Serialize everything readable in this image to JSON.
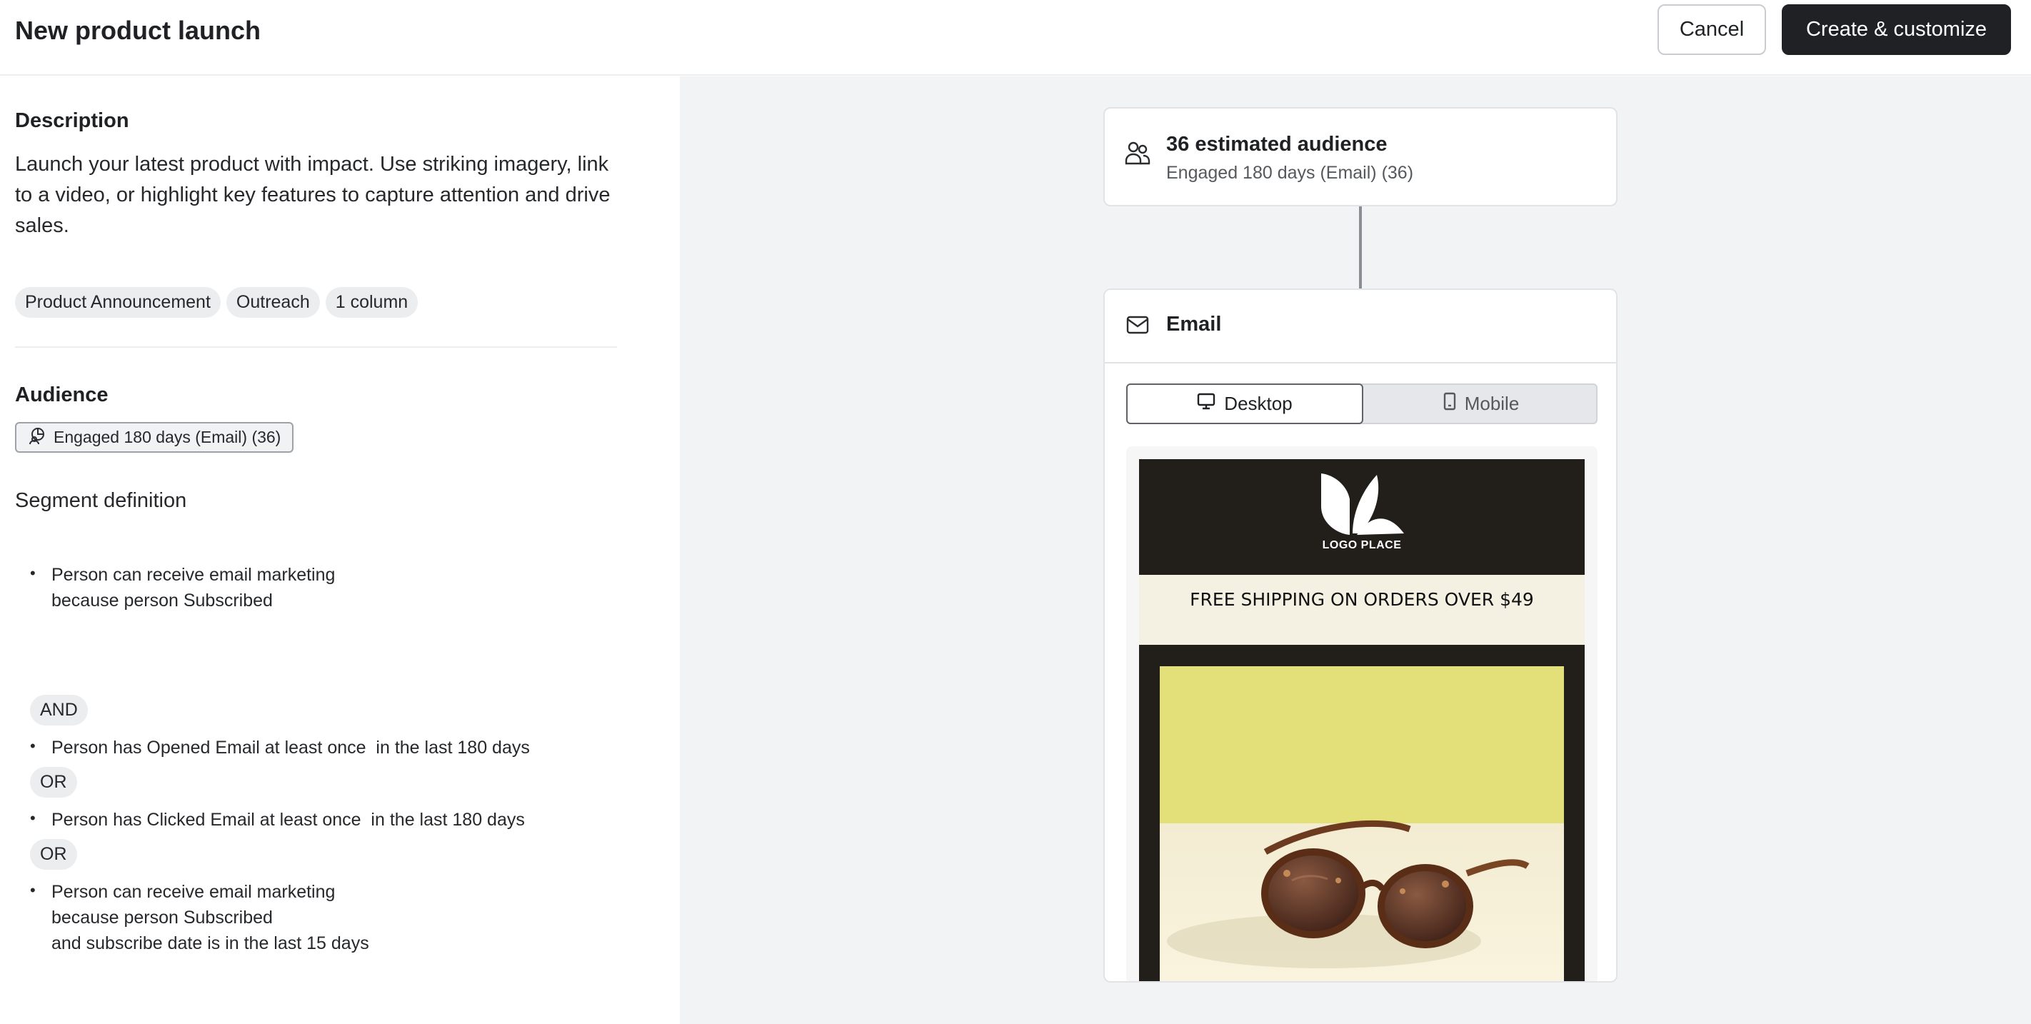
{
  "header": {
    "title": "New product launch",
    "cancel_label": "Cancel",
    "create_label": "Create & customize"
  },
  "description": {
    "heading": "Description",
    "text": "Launch your latest product with impact. Use striking imagery, link to a video, or highlight key features to capture attention and drive sales.",
    "tags": [
      "Product Announcement",
      "Outreach",
      "1 column"
    ]
  },
  "audience": {
    "heading": "Audience",
    "chip_label": "Engaged 180 days (Email) (36)",
    "segment_title": "Segment definition",
    "rules": [
      "Person can receive email marketing\nbecause person Subscribed",
      "Person has Opened Email at least once  in the last 180 days",
      "Person has Clicked Email at least once  in the last 180 days",
      "Person can receive email marketing\nbecause person Subscribed\nand subscribe date is in the last 15 days"
    ],
    "operators": [
      "AND",
      "OR",
      "OR"
    ]
  },
  "flow": {
    "audience_card": {
      "count_label": "36 estimated audience",
      "sub_label": "Engaged 180 days (Email) (36)",
      "icon": "people-icon"
    },
    "email_card": {
      "title": "Email",
      "icon": "mail-icon",
      "toggle": {
        "desktop_label": "Desktop",
        "mobile_label": "Mobile",
        "selected": "Desktop"
      },
      "preview": {
        "logo_text": "LOGO PLACE",
        "shipping_text": "FREE SHIPPING ON ORDERS OVER $49"
      }
    }
  },
  "colors": {
    "primary_button": "#1f2124",
    "canvas_bg": "#f2f3f5",
    "email_dark": "#221e1a",
    "email_cream": "#f4f1e3",
    "hero_yellow": "#e3e07a"
  }
}
